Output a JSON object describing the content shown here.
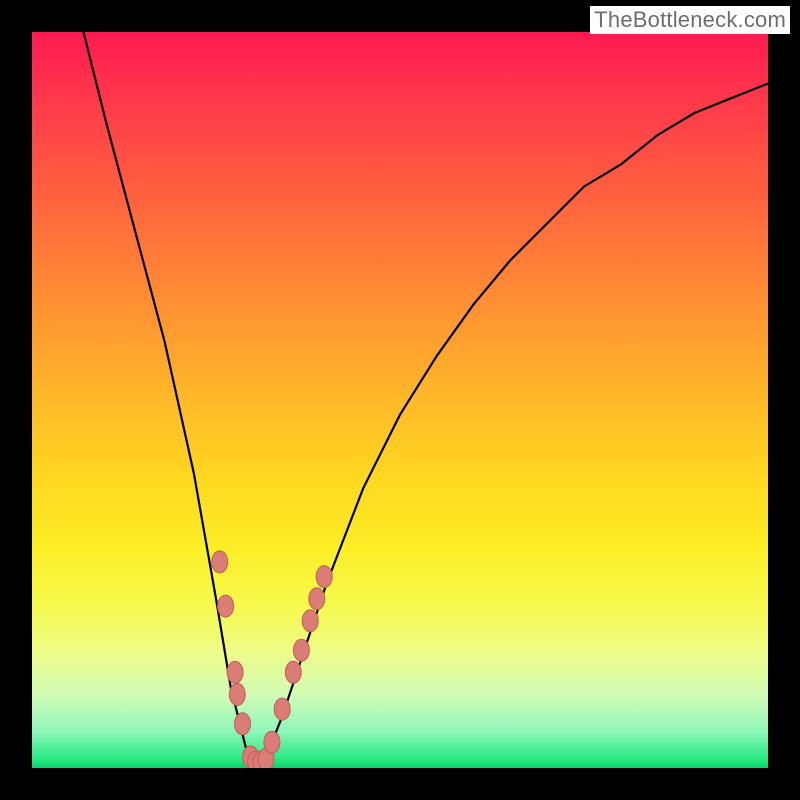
{
  "watermark": "TheBottleneck.com",
  "colors": {
    "frame": "#000000",
    "gradient_top": "#ff1a52",
    "gradient_mid": "#ffd620",
    "gradient_bottom": "#0cce6b",
    "curve": "#000000",
    "data_points": "#db7c76"
  },
  "chart_data": {
    "type": "line",
    "title": "",
    "xlabel": "",
    "ylabel": "",
    "xlim": [
      0,
      100
    ],
    "ylim": [
      0,
      100
    ],
    "series": [
      {
        "name": "bottleneck-curve",
        "x": [
          7,
          10,
          14,
          18,
          22,
          25,
          27,
          29,
          30,
          31,
          32,
          34,
          37,
          40,
          45,
          50,
          55,
          60,
          65,
          70,
          75,
          80,
          85,
          90,
          95,
          100
        ],
        "y": [
          100,
          88,
          73,
          58,
          40,
          23,
          11,
          3,
          0,
          0,
          2,
          7,
          16,
          25,
          38,
          48,
          56,
          63,
          69,
          74,
          79,
          82,
          86,
          89,
          91,
          93
        ]
      }
    ],
    "scatter": {
      "name": "highlighted-points",
      "points": [
        {
          "x": 25.5,
          "y": 28
        },
        {
          "x": 26.3,
          "y": 22
        },
        {
          "x": 27.6,
          "y": 13
        },
        {
          "x": 27.9,
          "y": 10
        },
        {
          "x": 28.6,
          "y": 6
        },
        {
          "x": 29.7,
          "y": 1.5
        },
        {
          "x": 30.4,
          "y": 0.8
        },
        {
          "x": 31.1,
          "y": 0.8
        },
        {
          "x": 31.8,
          "y": 1.2
        },
        {
          "x": 32.6,
          "y": 3.5
        },
        {
          "x": 34.0,
          "y": 8
        },
        {
          "x": 35.5,
          "y": 13
        },
        {
          "x": 36.6,
          "y": 16
        },
        {
          "x": 37.8,
          "y": 20
        },
        {
          "x": 38.7,
          "y": 23
        },
        {
          "x": 39.7,
          "y": 26
        }
      ]
    },
    "annotations": []
  }
}
